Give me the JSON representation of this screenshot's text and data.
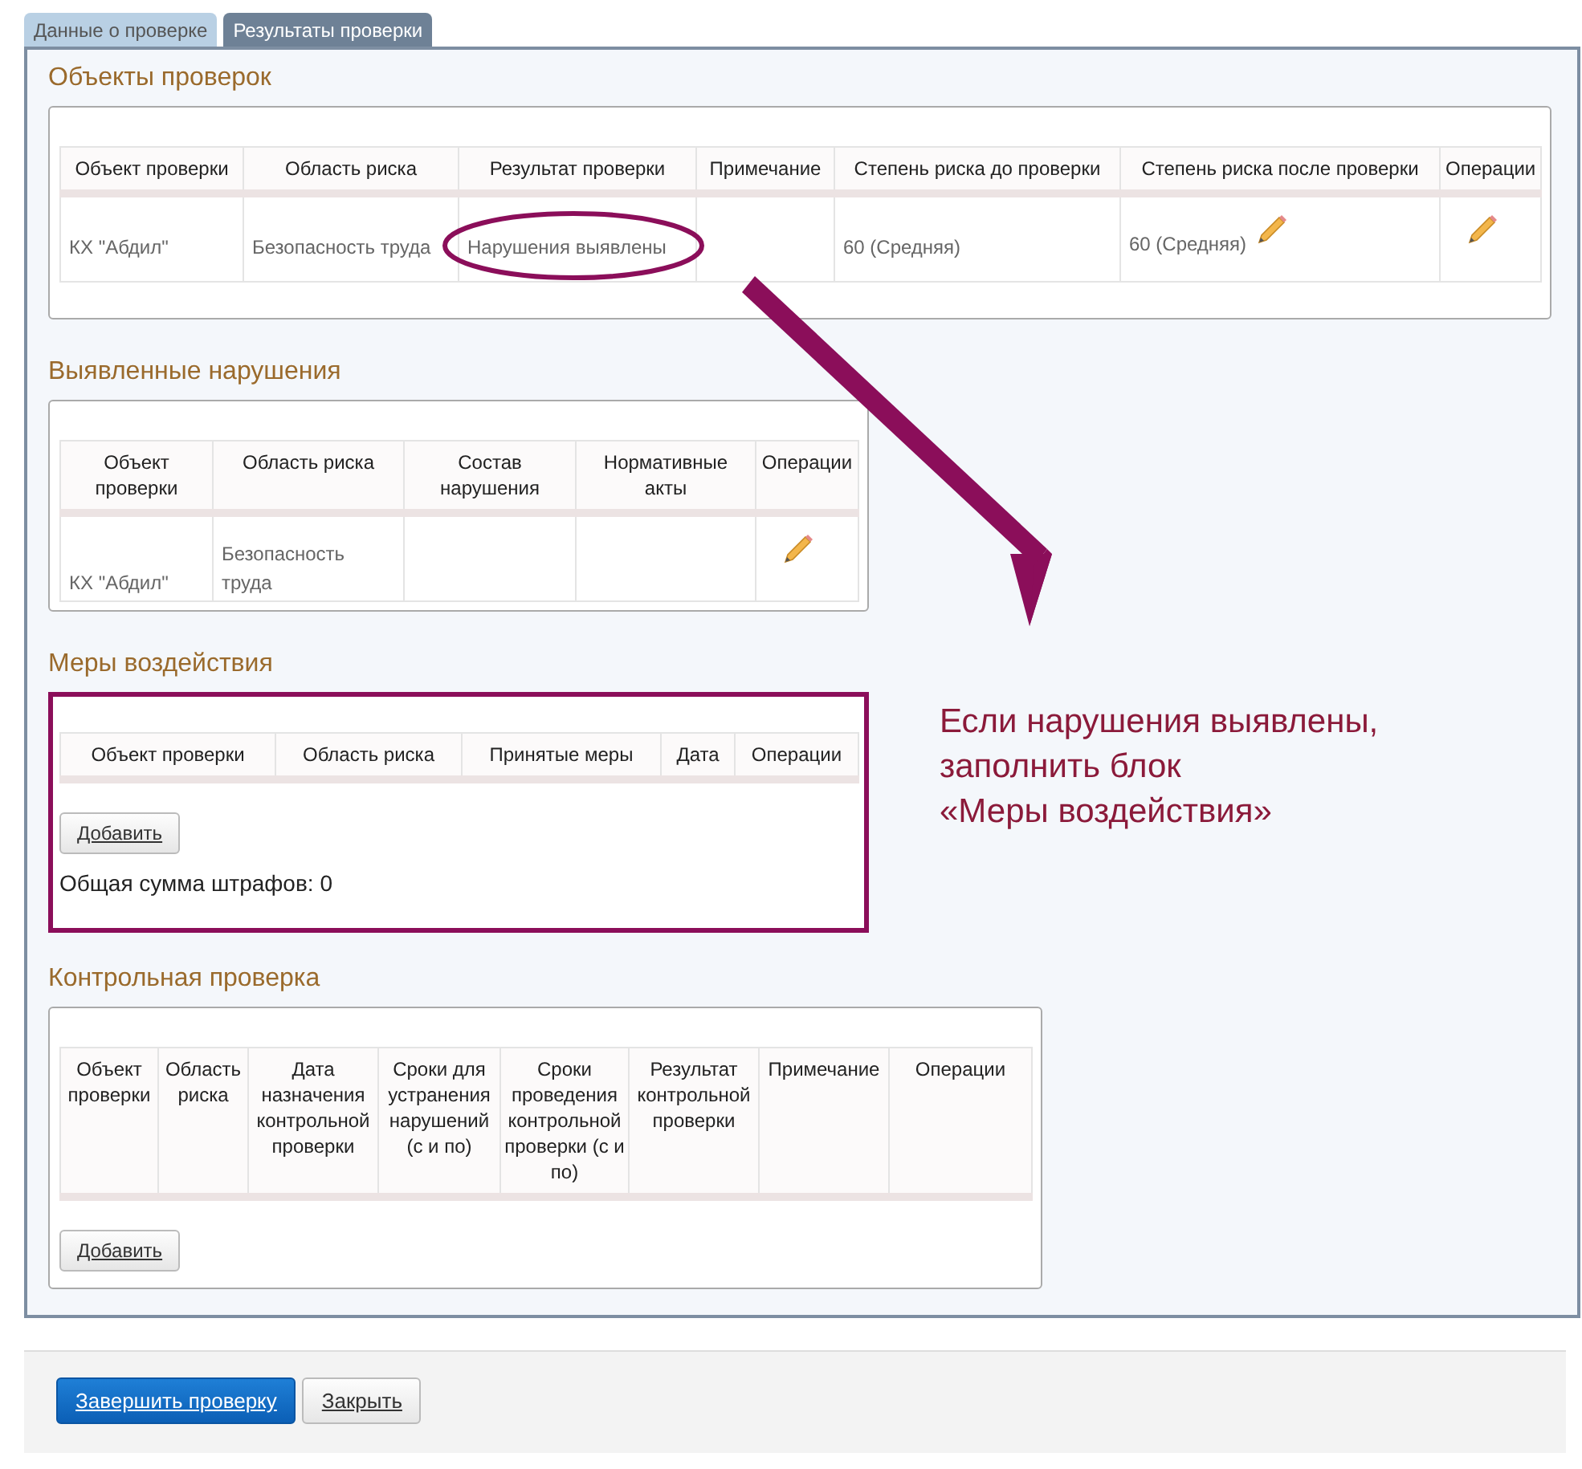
{
  "tabs": [
    {
      "label": "Данные о проверке",
      "selected": false
    },
    {
      "label": "Результаты проверки",
      "selected": true
    }
  ],
  "sections": [
    {
      "title": "Объекты проверок",
      "highlighted": false,
      "columns": [
        "Объект проверки",
        "Область риска",
        "Результат проверки",
        "Примечание",
        "Степень риска до проверки",
        "Степень риска после проверки",
        "Операции"
      ],
      "rows": [
        [
          {
            "kind": "text",
            "text": "КХ \"Абдил\""
          },
          {
            "kind": "text",
            "text": "Безопасность труда"
          },
          {
            "kind": "text",
            "text": "Нарушения выявлены"
          },
          {
            "kind": "empty"
          },
          {
            "kind": "text",
            "text": "60 (Средняя)"
          },
          {
            "kind": "text_edit",
            "text": "60 (Средняя)"
          },
          {
            "kind": "edit"
          }
        ]
      ]
    },
    {
      "title": "Выявленные нарушения",
      "highlighted": false,
      "columns": [
        "Объект проверки",
        "Область риска",
        "Состав нарушения",
        "Нормативные акты",
        "Операции"
      ],
      "rows": [
        [
          {
            "kind": "text",
            "text": "КХ \"Абдил\""
          },
          {
            "kind": "text",
            "text": "Безопасность труда"
          },
          {
            "kind": "empty"
          },
          {
            "kind": "empty"
          },
          {
            "kind": "edit"
          }
        ]
      ]
    },
    {
      "title": "Меры воздействия",
      "highlighted": true,
      "columns": [
        "Объект проверки",
        "Область риска",
        "Принятые меры",
        "Дата",
        "Операции"
      ],
      "add_button": "Добавить",
      "total": "Общая сумма штрафов: 0"
    },
    {
      "title": "Контрольная проверка",
      "highlighted": false,
      "columns": [
        "Объект проверки",
        "Область риска",
        "Дата назначения контрольной проверки",
        "Сроки для устранения нарушений (с и по)",
        "Сроки проведения контрольной проверки (с и по)",
        "Результат контрольной проверки",
        "Примечание",
        "Операции"
      ],
      "add_button": "Добавить"
    }
  ],
  "annotation": {
    "lines": [
      "Если нарушения выявлены,",
      "заполнить блок",
      "«Меры воздействия»"
    ]
  },
  "footer_buttons": [
    {
      "label": "Завершить проверку",
      "kind": "primary"
    },
    {
      "label": "Закрыть",
      "kind": "default"
    }
  ]
}
